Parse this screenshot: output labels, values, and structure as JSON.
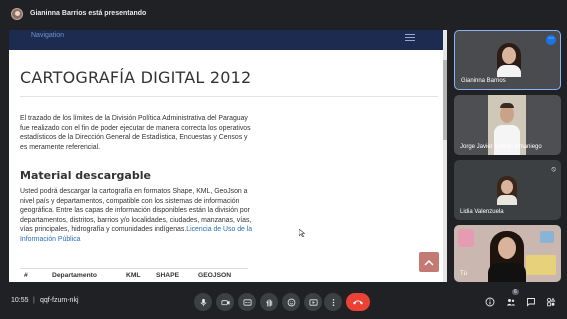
{
  "presenter_bar": {
    "text": "Gianinna Barrios está presentando"
  },
  "shared_page": {
    "nav_label": "Navigation",
    "title": "CARTOGRAFÍA DIGITAL 2012",
    "intro": "El trazado de los límites de la División Política Administrativa del Paraguay fue realizado con el fin de poder ejecutar de manera correcta los operativos estadísticos de la Dirección General de Estadística, Encuestas y Censos y es meramente referencial.",
    "section_title": "Material descargable",
    "description": "Usted podrá descargar la cartografía en formatos Shape, KML, GeoJson a nivel país y departamentos, compatible con los sistemas de información geográfica. Entre las capas de información disponibles están la división por departamentos, distritos, barrios y/o localidades, ciudades, manzanas, vías, vías principales, hidrografía y comunidades indígenas.",
    "license_link": "Licencia de Uso de la Información Pública",
    "table_headers": [
      "#",
      "Departamento",
      "KML",
      "SHAPE",
      "GEOJSON"
    ]
  },
  "participants": [
    {
      "name": "Gianinna Barrios",
      "active": true
    },
    {
      "name": "Jorge Javier Galván Amaniego",
      "active": false
    },
    {
      "name": "Lidia Valenzuela",
      "active": false
    },
    {
      "name": "Tú",
      "active": false
    }
  ],
  "bottom_bar": {
    "time": "10:55",
    "separator": "|",
    "meeting_code": "qqf-fzum-nkj",
    "people_count": "6"
  },
  "colors": {
    "accent": "#1a73e8",
    "hangup": "#ea4335",
    "nav": "#1c2b4f",
    "link": "#2d6db5",
    "scroll_top": "#c27a73"
  }
}
